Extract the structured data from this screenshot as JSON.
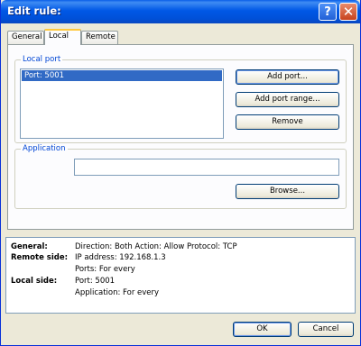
{
  "window": {
    "title": "Edit rule:"
  },
  "titlebar": {
    "help_glyph": "?",
    "close_glyph": "✕"
  },
  "tabs": [
    {
      "label": "General",
      "active": false
    },
    {
      "label": "Local",
      "active": true
    },
    {
      "label": "Remote",
      "active": false
    }
  ],
  "local_port": {
    "legend": "Local port",
    "items": [
      "Port: 5001"
    ],
    "selected_index": 0,
    "add_port": "Add port...",
    "add_port_range": "Add port range...",
    "remove": "Remove"
  },
  "application": {
    "legend": "Application",
    "value": "",
    "browse": "Browse..."
  },
  "summary": {
    "rows": [
      {
        "key": "General:",
        "value": "Direction: Both   Action: Allow   Protocol: TCP"
      },
      {
        "key": "Remote side:",
        "value": "IP address: 192.168.1.3"
      },
      {
        "key": "",
        "value": "Ports: For every"
      },
      {
        "key": "Local side:",
        "value": "Port: 5001"
      },
      {
        "key": "",
        "value": "Application: For every"
      }
    ]
  },
  "footer": {
    "ok": "OK",
    "cancel": "Cancel"
  },
  "colors": {
    "titlebar": "#0054e3",
    "selection": "#316ac5",
    "legend": "#0046d5",
    "dialog_bg": "#ece9d8"
  },
  "icons": {
    "help": "help-icon",
    "close": "close-icon"
  }
}
